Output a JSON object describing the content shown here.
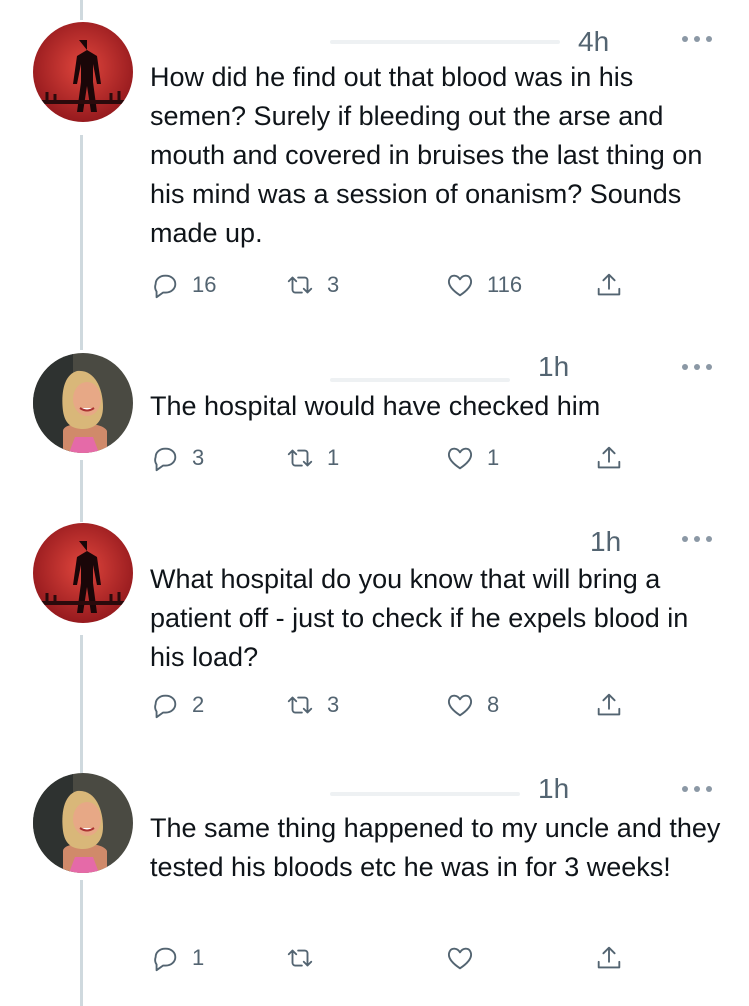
{
  "tweets": [
    {
      "time": "4h",
      "text": "How did he find out that blood was in his semen? Surely if bleeding out the arse and mouth and covered in bruises the last thing on his mind was a session of onanism? Sounds made up.",
      "replies": "16",
      "retweets": "3",
      "likes": "116",
      "avatar": "dark-figure"
    },
    {
      "time": "1h",
      "text": "The hospital would have checked him",
      "replies": "3",
      "retweets": "1",
      "likes": "1",
      "avatar": "woman-portrait"
    },
    {
      "time": "1h",
      "text": "What hospital do you know that will bring a patient off - just to check if he expels blood in his load?",
      "replies": "2",
      "retweets": "3",
      "likes": "8",
      "avatar": "dark-figure"
    },
    {
      "time": "1h",
      "text": "The same thing happened to my uncle and they tested his bloods etc he was in for 3 weeks!",
      "replies": "1",
      "retweets": "",
      "likes": "",
      "avatar": "woman-portrait"
    }
  ],
  "icons": {
    "reply": "reply-icon",
    "retweet": "retweet-icon",
    "like": "heart-icon",
    "share": "share-icon",
    "more": "more-icon"
  },
  "colors": {
    "text": "#0f1419",
    "secondary": "#536471",
    "thread_line": "#cfd9de",
    "avatar_red": "#b3242a"
  }
}
